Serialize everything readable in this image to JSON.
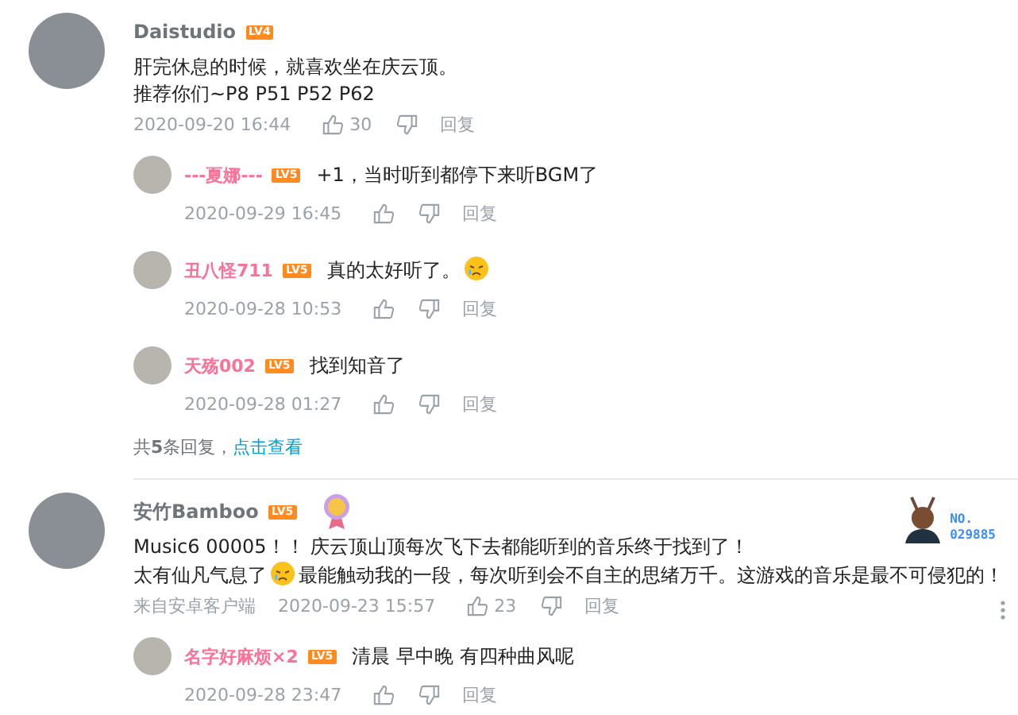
{
  "comments": [
    {
      "user": "Daistudio",
      "level": "LV4",
      "vip": false,
      "medal": false,
      "lines": [
        [
          {
            "kind": "text",
            "text": "肝完休息的时候，就喜欢坐在庆云顶。"
          }
        ],
        [
          {
            "kind": "text",
            "text": "推荐你们~P8 P51 P52 P62"
          }
        ]
      ],
      "time": "2020-09-20 16:44",
      "likes": "30",
      "reply_label": "回复",
      "replies": [
        {
          "user": "---夏娜---",
          "level": "LV5",
          "vip": true,
          "content": [
            {
              "kind": "text",
              "text": "+1，当时听到都停下来听BGM了"
            }
          ],
          "time": "2020-09-29 16:45",
          "reply_label": "回复"
        },
        {
          "user": "丑八怪711",
          "level": "LV5",
          "vip": true,
          "content": [
            {
              "kind": "text",
              "text": "真的太好听了。"
            },
            {
              "kind": "emoji"
            }
          ],
          "time": "2020-09-28 10:53",
          "reply_label": "回复"
        },
        {
          "user": "天殇002",
          "level": "LV5",
          "vip": true,
          "content": [
            {
              "kind": "text",
              "text": "找到知音了"
            }
          ],
          "time": "2020-09-28 01:27",
          "reply_label": "回复"
        }
      ],
      "replies_summary": {
        "text": "共**5**条回复，",
        "link": "点击查看"
      }
    },
    {
      "user": "安竹Bamboo",
      "level": "LV5",
      "vip": false,
      "medal": true,
      "fan_badge": {
        "label": "NO.",
        "number": "029885"
      },
      "lines": [
        [
          {
            "kind": "text",
            "text": "Music6 00005！！ 庆云顶山顶每次飞下去都能听到的音乐终于找到了！"
          }
        ],
        [
          {
            "kind": "text",
            "text": "太有仙凡气息了"
          },
          {
            "kind": "emoji"
          },
          {
            "kind": "text",
            "text": "最能触动我的一段，每次听到会不自主的思绪万千。这游戏的音乐是最不可侵犯的！"
          }
        ]
      ],
      "source": "来自安卓客户端",
      "time": "2020-09-23 15:57",
      "likes": "23",
      "reply_label": "回复",
      "replies": [
        {
          "user": "名字好麻烦×2",
          "level": "LV5",
          "vip": true,
          "content": [
            {
              "kind": "text",
              "text": "清晨 早中晚 有四种曲风呢"
            }
          ],
          "time": "2020-09-28 23:47",
          "reply_label": "回复"
        }
      ]
    }
  ]
}
